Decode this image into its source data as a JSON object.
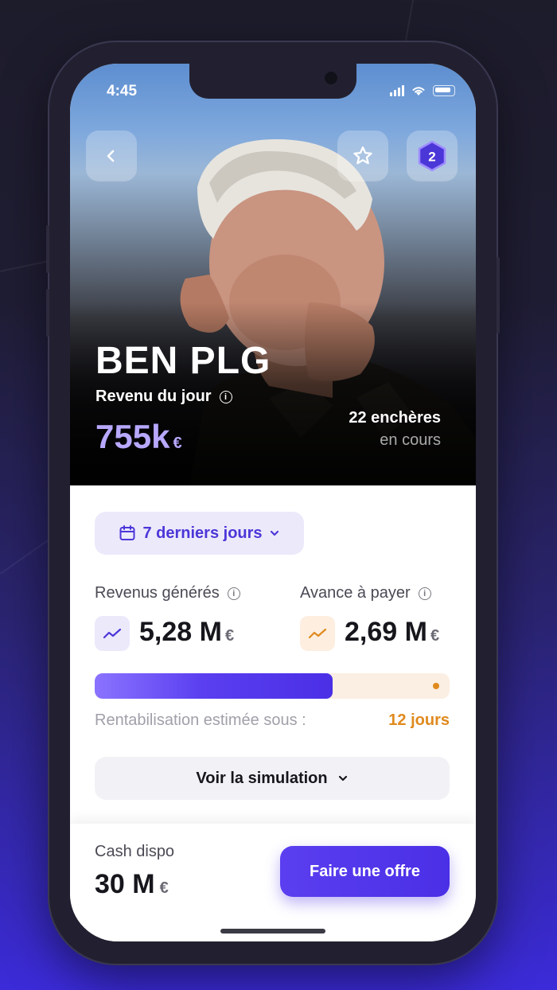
{
  "status_bar": {
    "time": "4:45"
  },
  "hero": {
    "artist_name": "BEN PLG",
    "revenue_label": "Revenu du jour",
    "revenue_value": "755k",
    "revenue_unit": "€",
    "auctions_count": "22 enchères",
    "auctions_sub": "en cours",
    "badge_level": "2"
  },
  "period": {
    "label": "7 derniers jours"
  },
  "stats": {
    "revenus": {
      "label": "Revenus générés",
      "value": "5,28 M",
      "unit": "€"
    },
    "avance": {
      "label": "Avance à payer",
      "value": "2,69 M",
      "unit": "€"
    }
  },
  "progress": {
    "fill_fraction": 0.67
  },
  "rentab": {
    "label": "Rentabilisation estimée sous :",
    "value": "12 jours"
  },
  "simulation": {
    "label": "Voir la simulation"
  },
  "bottom": {
    "cash_label": "Cash dispo",
    "cash_value": "30 M",
    "cash_unit": "€",
    "offer_button": "Faire une offre"
  },
  "colors": {
    "accent": "#4b36d8",
    "accent_light": "#b8a8ff",
    "orange": "#e08a1e"
  }
}
